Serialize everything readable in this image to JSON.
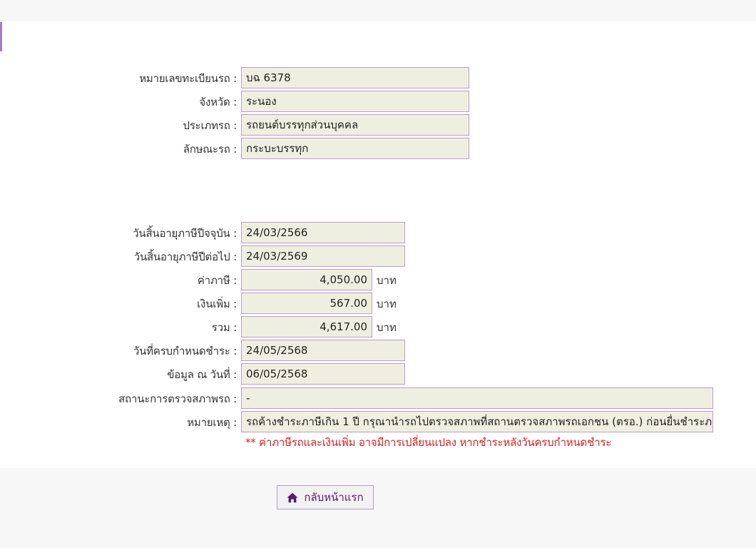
{
  "vehicle": {
    "plate_label": "หมายเลขทะเบียนรถ :",
    "plate_value": "บฉ 6378",
    "province_label": "จังหวัด :",
    "province_value": "ระนอง",
    "type_label": "ประเภทรถ :",
    "type_value": "รถยนต์บรรทุกส่วนบุคคล",
    "style_label": "ลักษณะรถ :",
    "style_value": "กระบะบรรทุก"
  },
  "tax": {
    "current_expiry_label": "วันสิ้นอายุภาษีปีจจุบัน :",
    "current_expiry_value": "24/03/2566",
    "next_expiry_label": "วันสิ้นอายุภาษีปีต่อไป :",
    "next_expiry_value": "24/03/2569",
    "tax_label": "ค่าภาษี :",
    "tax_value": "4,050.00",
    "surcharge_label": "เงินเพิ่ม :",
    "surcharge_value": "567.00",
    "total_label": "รวม :",
    "total_value": "4,617.00",
    "currency_unit": "บาท",
    "due_date_label": "วันที่ครบกำหนดชำระ :",
    "due_date_value": "24/05/2568",
    "data_as_of_label": "ข้อมูล ณ วันที่ :",
    "data_as_of_value": "06/05/2568",
    "inspection_status_label": "สถานะการตรวจสภาพรถ :",
    "inspection_status_value": "-",
    "remark_label": "หมายเหตุ :",
    "remark_value": "รถค้างชำระภาษีเกิน 1 ปี กรุณานำรถไปตรวจสภาพที่สถานตรวจสภาพรถเอกชน (ตรอ.) ก่อนยื่นชำระภาษี",
    "warning_note": "** ค่าภาษีรถและเงินเพิ่ม อาจมีการเปลี่ยนแปลง หากชำระหลังวันครบกำหนดชำระ"
  },
  "actions": {
    "home_label": "กลับหน้าแรก",
    "home_icon": "home-icon"
  },
  "colors": {
    "accent": "#a57cc4",
    "field_bg": "#efefe1",
    "field_border": "#b99ccd",
    "warning": "#d81f1f",
    "button_text": "#5a1a6e"
  }
}
